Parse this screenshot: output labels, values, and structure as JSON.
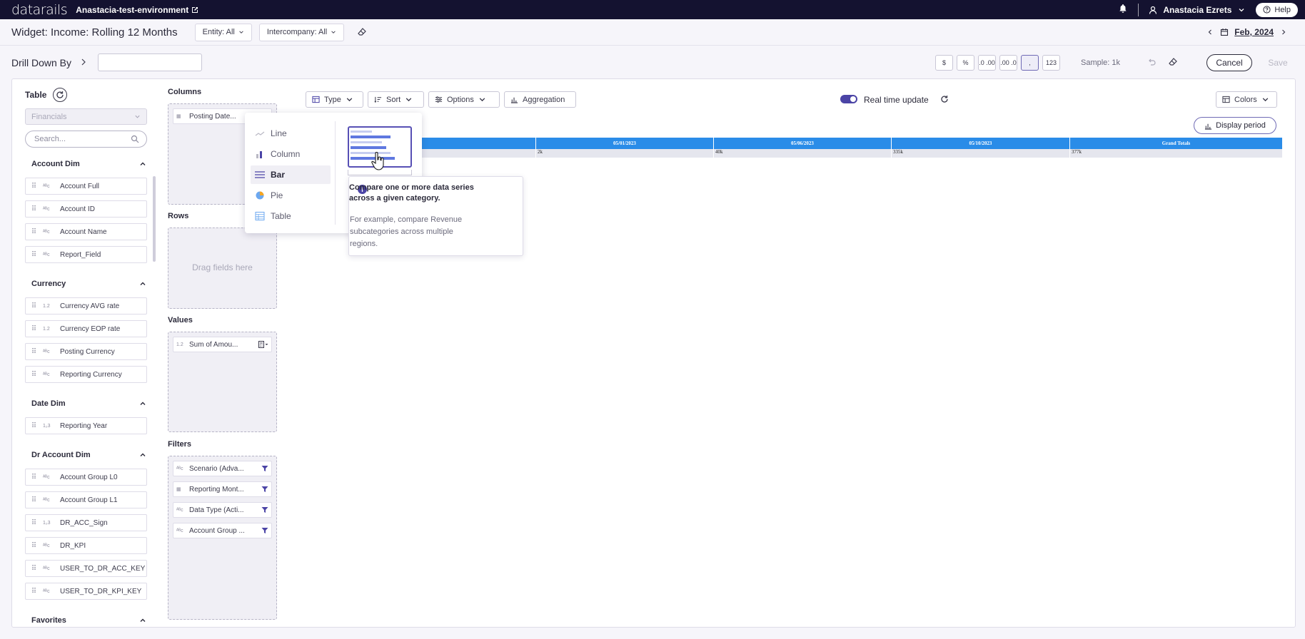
{
  "topbar": {
    "logo": "datarails",
    "environment": "Anastacia-test-environment",
    "user_name": "Anastacia Ezrets",
    "help_label": "Help"
  },
  "header": {
    "widget_title": "Widget: Income: Rolling 12 Months",
    "entity_filter": "Entity: All",
    "intercompany_filter": "Intercompany: All",
    "date": "Feb, 2024"
  },
  "drill": {
    "label": "Drill Down By",
    "input_value": "",
    "format_buttons": [
      "$",
      "%",
      ".0 .00",
      ".00 .0",
      ",",
      "123"
    ],
    "sample_label": "Sample: 1k",
    "cancel_label": "Cancel",
    "save_label": "Save"
  },
  "left": {
    "table_label": "Table",
    "table_value": "Financials",
    "search_placeholder": "Search...",
    "sections": [
      {
        "title": "Account Dim",
        "fields": [
          {
            "type": "ABC",
            "name": "Account Full"
          },
          {
            "type": "ABC",
            "name": "Account ID"
          },
          {
            "type": "ABC",
            "name": "Account Name"
          },
          {
            "type": "ABC",
            "name": "Report_Field"
          }
        ]
      },
      {
        "title": "Currency",
        "fields": [
          {
            "type": "1.2",
            "name": "Currency AVG rate"
          },
          {
            "type": "1.2",
            "name": "Currency EOP rate"
          },
          {
            "type": "ABC",
            "name": "Posting Currency"
          },
          {
            "type": "ABC",
            "name": "Reporting Currency"
          }
        ]
      },
      {
        "title": "Date Dim",
        "fields": [
          {
            "type": "123",
            "name": "Reporting Year"
          }
        ]
      },
      {
        "title": "Dr Account Dim",
        "fields": [
          {
            "type": "ABC",
            "name": "Account Group L0"
          },
          {
            "type": "ABC",
            "name": "Account Group L1"
          },
          {
            "type": "123",
            "name": "DR_ACC_Sign"
          },
          {
            "type": "ABC",
            "name": "DR_KPI"
          },
          {
            "type": "ABC",
            "name": "USER_TO_DR_ACC_KEY"
          },
          {
            "type": "ABC",
            "name": "USER_TO_DR_KPI_KEY"
          }
        ]
      },
      {
        "title": "Favorites",
        "fields": []
      }
    ]
  },
  "zones": {
    "columns_label": "Columns",
    "columns_item": "Posting Date...",
    "rows_label": "Rows",
    "rows_placeholder": "Drag fields here",
    "values_label": "Values",
    "values_item": "Sum of Amou...",
    "filters_label": "Filters",
    "filters": [
      "Scenario (Adva...",
      "Reporting Mont...",
      "Data Type (Acti...",
      "Account Group ..."
    ]
  },
  "toolbar": {
    "type_label": "Type",
    "sort_label": "Sort",
    "options_label": "Options",
    "aggregation_label": "Aggregation",
    "realtime_label": "Real time update",
    "colors_label": "Colors",
    "display_period_label": "Display period"
  },
  "preview_table": {
    "headers": [
      "05/01/2023",
      "05/06/2023",
      "05/10/2023",
      "Grand Totals"
    ],
    "values": [
      "2k",
      "40k",
      "335k",
      "377k"
    ]
  },
  "chart_type_menu": {
    "items": [
      "Line",
      "Column",
      "Bar",
      "Pie",
      "Table"
    ],
    "selected": "Bar"
  },
  "tooltip": {
    "title_line1": "Compare one or more data series",
    "title_line2": "across a given category.",
    "body_line1": "For example, compare Revenue",
    "body_line2": "subcategories across multiple",
    "body_line3": "regions."
  }
}
